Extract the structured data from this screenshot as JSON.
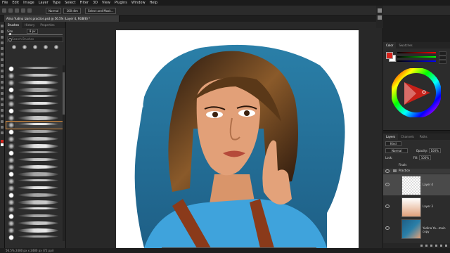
{
  "menubar": {
    "items": [
      "File",
      "Edit",
      "Image",
      "Layer",
      "Type",
      "Select",
      "Filter",
      "3D",
      "View",
      "Plugins",
      "Window",
      "Help"
    ]
  },
  "options": {
    "mode": "Normal",
    "opacity": "100 dlm",
    "button": "Select and Mask..."
  },
  "document": {
    "tab_title": "Alina Yudina Izaris practice.psd @ 56.5% (Layer 4, RGB/8) *"
  },
  "brushes_panel": {
    "tabs": [
      "Brushes",
      "History",
      "Properties"
    ],
    "size_label": "Size",
    "size_value": "8 px",
    "search_placeholder": "Search Brushes"
  },
  "color_panel": {
    "tabs": [
      "Color",
      "Swatches"
    ],
    "foreground": "#d7231c",
    "background": "#ffffff"
  },
  "layers_panel": {
    "tabs": [
      "Layers",
      "Channels",
      "Paths"
    ],
    "kind_label": "Kind",
    "blend_mode": "Normal",
    "opacity_label": "Opacity:",
    "opacity_value": "100%",
    "lock_label": "Lock:",
    "fill_label": "Fill:",
    "fill_value": "100%",
    "groups": [
      "Finals",
      "Practice"
    ],
    "layers": [
      {
        "name": "Layer 4"
      },
      {
        "name": "Layer 3"
      },
      {
        "name": "Yudina Ya...main copy"
      }
    ]
  },
  "status": {
    "text": "56.5% 2480 px x 2480 px (72 ppi)"
  }
}
